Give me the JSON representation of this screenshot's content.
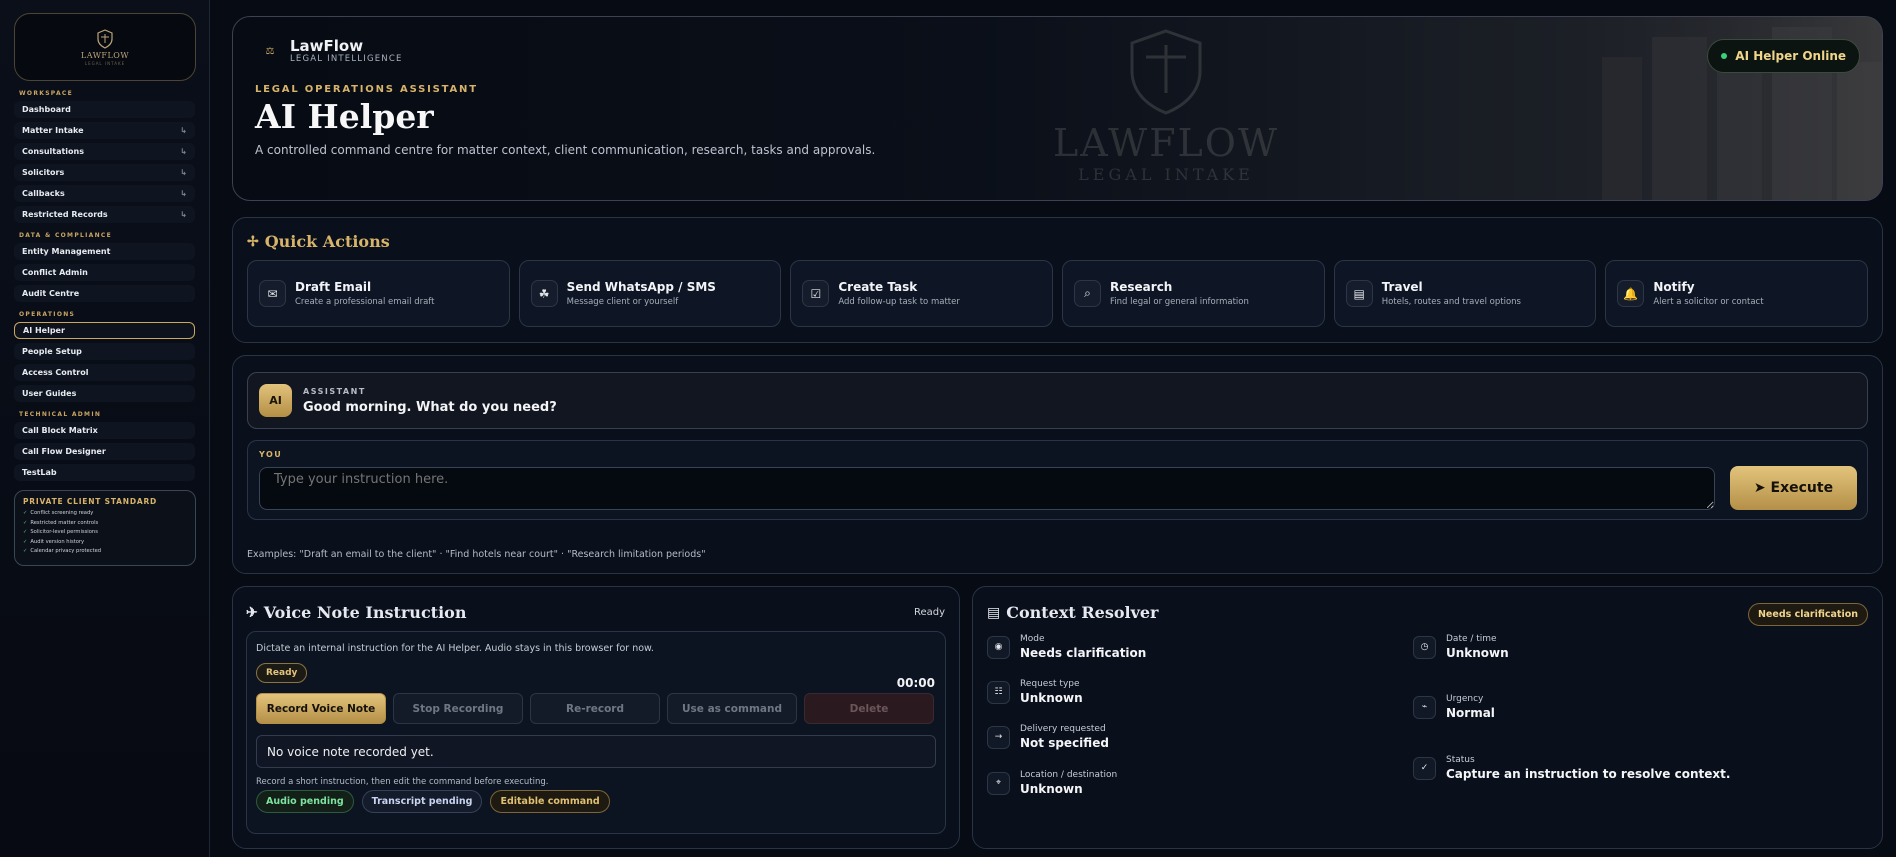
{
  "sidebar": {
    "logo_text": "LAWFLOW",
    "logo_sub": "LEGAL INTAKE",
    "sections": [
      {
        "title": "WORKSPACE",
        "items": [
          {
            "label": "Dashboard",
            "arrow": ""
          },
          {
            "label": "Matter Intake",
            "arrow": "↳"
          },
          {
            "label": "Consultations",
            "arrow": "↳"
          },
          {
            "label": "Solicitors",
            "arrow": "↳"
          },
          {
            "label": "Callbacks",
            "arrow": "↳"
          },
          {
            "label": "Restricted Records",
            "arrow": "↳"
          }
        ]
      },
      {
        "title": "DATA & COMPLIANCE",
        "items": [
          {
            "label": "Entity Management",
            "arrow": ""
          },
          {
            "label": "Conflict Admin",
            "arrow": ""
          },
          {
            "label": "Audit Centre",
            "arrow": ""
          }
        ]
      },
      {
        "title": "OPERATIONS",
        "items": [
          {
            "label": "AI Helper",
            "arrow": "",
            "active": true
          },
          {
            "label": "People Setup",
            "arrow": ""
          },
          {
            "label": "Access Control",
            "arrow": ""
          },
          {
            "label": "User Guides",
            "arrow": ""
          }
        ]
      },
      {
        "title": "TECHNICAL ADMIN",
        "items": [
          {
            "label": "Call Block Matrix",
            "arrow": ""
          },
          {
            "label": "Call Flow Designer",
            "arrow": ""
          },
          {
            "label": "TestLab",
            "arrow": ""
          }
        ]
      }
    ],
    "standard": {
      "title": "PRIVATE CLIENT STANDARD",
      "lines": [
        "Conflict screening ready",
        "Restricted matter controls",
        "Solicitor-level permissions",
        "Audit version history",
        "Calendar privacy protected"
      ]
    }
  },
  "hero": {
    "brand_name": "LawFlow",
    "brand_sub": "LEGAL INTELLIGENCE",
    "eyebrow": "LEGAL OPERATIONS ASSISTANT",
    "title": "AI Helper",
    "description": "A controlled command centre for matter context, client communication, research, tasks and approvals.",
    "watermark_title": "LAWFLOW",
    "watermark_sub": "LEGAL INTAKE",
    "status_pill": "AI Helper Online"
  },
  "quick_actions": {
    "title": "Quick Actions",
    "items": [
      {
        "title": "Draft Email",
        "sub": "Create a professional email draft",
        "icon": "✉",
        "name": "mail-icon"
      },
      {
        "title": "Send WhatsApp / SMS",
        "sub": "Message client or yourself",
        "icon": "☘",
        "name": "chat-icon"
      },
      {
        "title": "Create Task",
        "sub": "Add follow-up task to matter",
        "icon": "☑",
        "name": "checkbox-icon"
      },
      {
        "title": "Research",
        "sub": "Find legal or general information",
        "icon": "⌕",
        "name": "search-icon"
      },
      {
        "title": "Travel",
        "sub": "Hotels, routes and travel options",
        "icon": "▤",
        "name": "list-icon"
      },
      {
        "title": "Notify",
        "sub": "Alert a solicitor or contact",
        "icon": "🔔",
        "name": "bell-icon"
      }
    ]
  },
  "chat": {
    "assistant_badge": "AI",
    "assistant_label": "ASSISTANT",
    "assistant_message": "Good morning. What do you need?",
    "you_label": "YOU",
    "input_placeholder": "Type your instruction here.",
    "execute_label": "➤ Execute",
    "examples": "Examples: \"Draft an email to the client\" · \"Find hotels near court\" · \"Research limitation periods\""
  },
  "voice": {
    "title": "Voice Note Instruction",
    "status": "Ready",
    "description": "Dictate an internal instruction for the AI Helper. Audio stays in this browser for now.",
    "ready_pill": "Ready",
    "timer": "00:00",
    "buttons": {
      "record": "Record Voice Note",
      "stop": "Stop Recording",
      "rerecord": "Re-record",
      "use": "Use as command",
      "delete": "Delete"
    },
    "empty_message": "No voice note recorded yet.",
    "hint": "Record a short instruction, then edit the command before executing.",
    "tags": {
      "audio": "Audio pending",
      "transcript": "Transcript pending",
      "editable": "Editable command"
    }
  },
  "context": {
    "title": "Context Resolver",
    "pill": "Needs clarification",
    "items": {
      "mode": {
        "label": "Mode",
        "value": "Needs clarification"
      },
      "request_type": {
        "label": "Request type",
        "value": "Unknown"
      },
      "delivery": {
        "label": "Delivery requested",
        "value": "Not specified"
      },
      "location": {
        "label": "Location / destination",
        "value": "Unknown"
      },
      "datetime": {
        "label": "Date / time",
        "value": "Unknown"
      },
      "urgency": {
        "label": "Urgency",
        "value": "Normal"
      },
      "status": {
        "label": "Status",
        "value": "Capture an instruction to resolve context."
      }
    }
  }
}
